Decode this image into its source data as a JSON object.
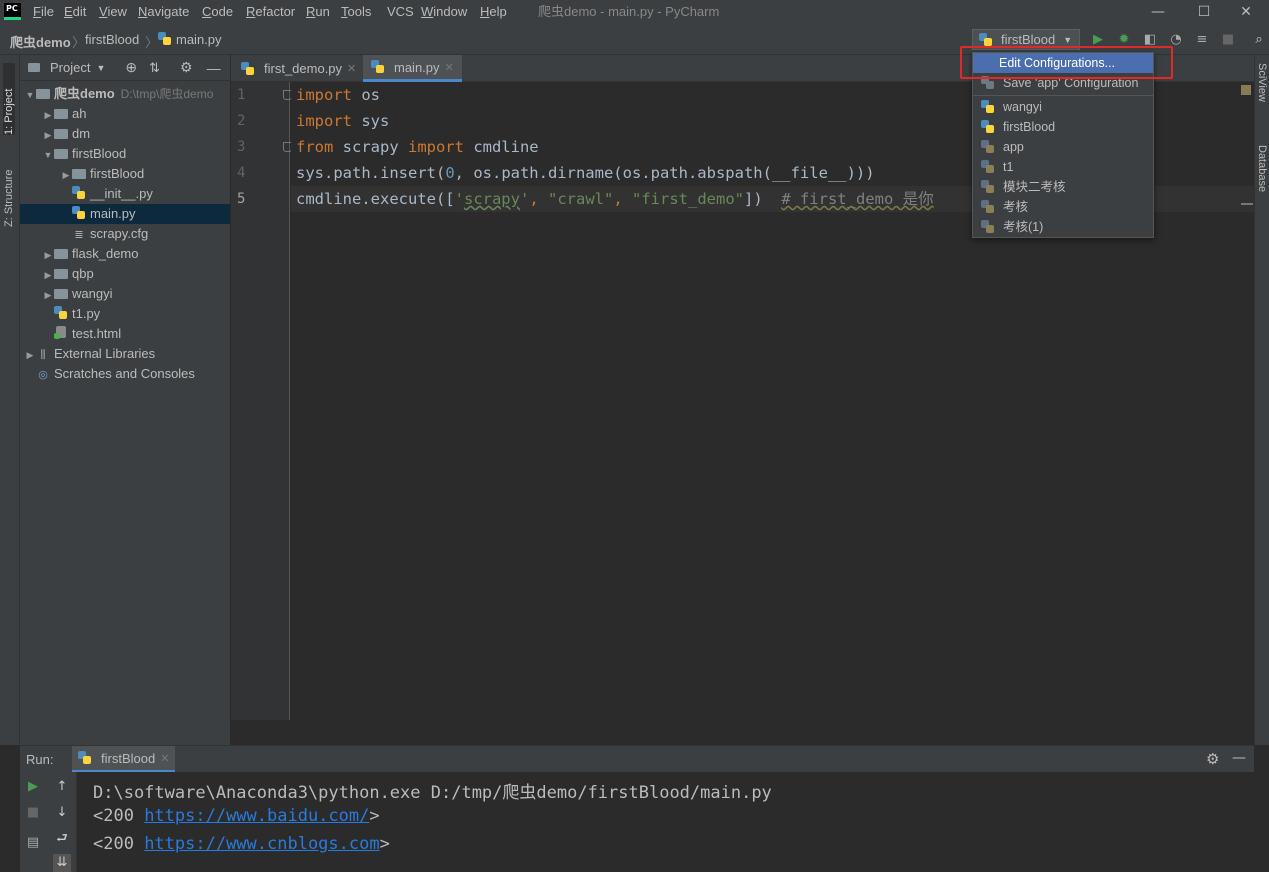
{
  "window": {
    "title": "爬虫demo - main.py - PyCharm",
    "logo_text": "PC",
    "minimize": "—",
    "maximize": "☐",
    "close": "✕"
  },
  "menu": [
    {
      "u": "F",
      "rest": "ile"
    },
    {
      "u": "E",
      "rest": "dit"
    },
    {
      "u": "V",
      "rest": "iew"
    },
    {
      "u": "N",
      "rest": "avigate"
    },
    {
      "u": "C",
      "rest": "ode"
    },
    {
      "u": "R",
      "rest": "efactor"
    },
    {
      "u": "R",
      "rest": "un"
    },
    {
      "u": "T",
      "rest": "ools"
    },
    {
      "u": "VCS",
      "rest": ""
    },
    {
      "u": "W",
      "rest": "indow"
    },
    {
      "u": "H",
      "rest": "elp"
    }
  ],
  "breadcrumb": [
    "爬虫demo",
    "firstBlood",
    "main.py"
  ],
  "run_config": {
    "selected": "firstBlood"
  },
  "left_stripe": {
    "project": "1: Project",
    "structure": "Z: Structure"
  },
  "right_stripe": {
    "sciview": "SciView",
    "database": "Database"
  },
  "project_panel": {
    "title": "Project",
    "tree": [
      {
        "label": "爬虫demo",
        "extra": "D:\\tmp\\爬虫demo",
        "indent": 0,
        "kind": "folder",
        "arrow": "▼"
      },
      {
        "label": "ah",
        "indent": 1,
        "kind": "folder",
        "arrow": "▶"
      },
      {
        "label": "dm",
        "indent": 1,
        "kind": "folder",
        "arrow": "▶"
      },
      {
        "label": "firstBlood",
        "indent": 1,
        "kind": "folder",
        "arrow": "▼"
      },
      {
        "label": "firstBlood",
        "indent": 2,
        "kind": "folder",
        "arrow": "▶"
      },
      {
        "label": "__init__.py",
        "indent": 2,
        "kind": "py",
        "arrow": ""
      },
      {
        "label": "main.py",
        "indent": 2,
        "kind": "py",
        "arrow": "",
        "selected": true
      },
      {
        "label": "scrapy.cfg",
        "indent": 2,
        "kind": "cfg",
        "arrow": ""
      },
      {
        "label": "flask_demo",
        "indent": 1,
        "kind": "folder",
        "arrow": "▶"
      },
      {
        "label": "qbp",
        "indent": 1,
        "kind": "folder",
        "arrow": "▶"
      },
      {
        "label": "wangyi",
        "indent": 1,
        "kind": "folder",
        "arrow": "▶"
      },
      {
        "label": "t1.py",
        "indent": 1,
        "kind": "py",
        "arrow": ""
      },
      {
        "label": "test.html",
        "indent": 1,
        "kind": "html",
        "arrow": ""
      },
      {
        "label": "External Libraries",
        "indent": 0,
        "kind": "lib",
        "arrow": "▶"
      },
      {
        "label": "Scratches and Consoles",
        "indent": 0,
        "kind": "scratch",
        "arrow": ""
      }
    ]
  },
  "tabs": [
    {
      "label": "first_demo.py",
      "active": false
    },
    {
      "label": "main.py",
      "active": true
    }
  ],
  "editor": {
    "line_numbers": [
      "1",
      "2",
      "3",
      "4",
      "5"
    ],
    "lines": [
      [
        {
          "t": "import",
          "c": "kw"
        },
        {
          "t": " os",
          "c": ""
        }
      ],
      [
        {
          "t": "import",
          "c": "kw"
        },
        {
          "t": " sys",
          "c": ""
        }
      ],
      [
        {
          "t": "from",
          "c": "kw"
        },
        {
          "t": " scrapy ",
          "c": ""
        },
        {
          "t": "import",
          "c": "kw"
        },
        {
          "t": " cmdline",
          "c": ""
        }
      ],
      [
        {
          "t": "sys.path.insert(",
          "c": ""
        },
        {
          "t": "0",
          "c": "num"
        },
        {
          "t": ", os.path.dirname(os.path.abspath(__file__)))",
          "c": ""
        }
      ],
      [
        {
          "t": "cmdline.execute([",
          "c": ""
        },
        {
          "t": "'",
          "c": "str"
        },
        {
          "t": "scrapy",
          "c": "str typo"
        },
        {
          "t": "'",
          "c": "str"
        },
        {
          "t": ", ",
          "c": "kw"
        },
        {
          "t": "\"crawl\"",
          "c": "str"
        },
        {
          "t": ", ",
          "c": "kw"
        },
        {
          "t": "\"first_demo\"",
          "c": "str"
        },
        {
          "t": "])  ",
          "c": ""
        },
        {
          "t": "# first_demo 是你",
          "c": "cmt"
        }
      ]
    ]
  },
  "run_panel": {
    "label": "Run:",
    "tab": "firstBlood",
    "console": [
      {
        "pre": "D:\\software\\Anaconda3\\python.exe D:/tmp/爬虫demo/firstBlood/main.py",
        "link": "",
        "post": ""
      },
      {
        "pre": "<200 ",
        "link": "https://www.baidu.com/",
        "post": ">"
      },
      {
        "pre": "<200 ",
        "link": "https://www.cnblogs.com",
        "post": ">"
      }
    ]
  },
  "popup": {
    "edit": "Edit Configurations...",
    "save": "Save 'app' Configuration",
    "configs": [
      "wangyi",
      "firstBlood",
      "app",
      "t1",
      "模块二考核",
      "考核",
      "考核(1)"
    ]
  },
  "colors": {
    "accent": "#4b6eaf",
    "highlight_box": "#e02a2a",
    "run_green": "#499c54"
  }
}
